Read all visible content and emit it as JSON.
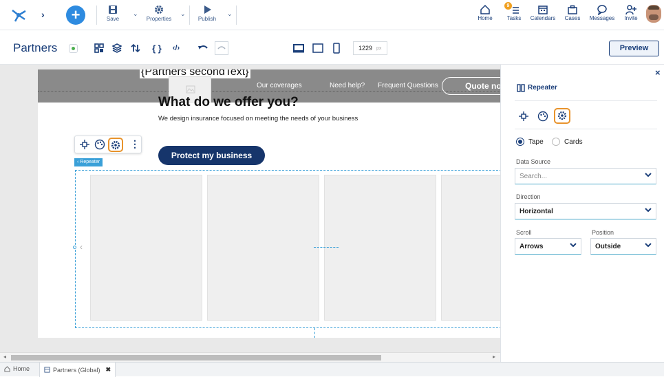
{
  "toolbar": {
    "save_label": "Save",
    "properties_label": "Properties",
    "publish_label": "Publish",
    "home_label": "Home",
    "tasks_label": "Tasks",
    "tasks_badge": "9",
    "calendars_label": "Calendars",
    "cases_label": "Cases",
    "messages_label": "Messages",
    "invite_label": "Invite"
  },
  "titlebar": {
    "page_title": "Partners",
    "width_value": "1229",
    "width_unit": "px",
    "preview_label": "Preview"
  },
  "canvas": {
    "header_text": "{Partners secondText}",
    "nav": [
      "Our coverages",
      "Need help?",
      "Frequent Questions"
    ],
    "quote_button": "Quote now",
    "heading": "What do we offer you?",
    "subheading": "We design insurance focused on meeting the needs of your business",
    "cta_button": "Protect my business",
    "repeater_tag": "‹ Repeater"
  },
  "panel": {
    "title": "Repeater",
    "radio_tape": "Tape",
    "radio_cards": "Cards",
    "data_source_label": "Data Source",
    "data_source_placeholder": "Search...",
    "direction_label": "Direction",
    "direction_value": "Horizontal",
    "scroll_label": "Scroll",
    "scroll_value": "Arrows",
    "position_label": "Position",
    "position_value": "Outside",
    "close_symbol": "×"
  },
  "bottom": {
    "home_tab": "Home",
    "partners_tab": "Partners (Global)"
  },
  "colors": {
    "brand_blue": "#1b3f7a",
    "accent_orange": "#e8932c",
    "primary_button": "#16356b",
    "header_gray": "#8a8a8a"
  }
}
